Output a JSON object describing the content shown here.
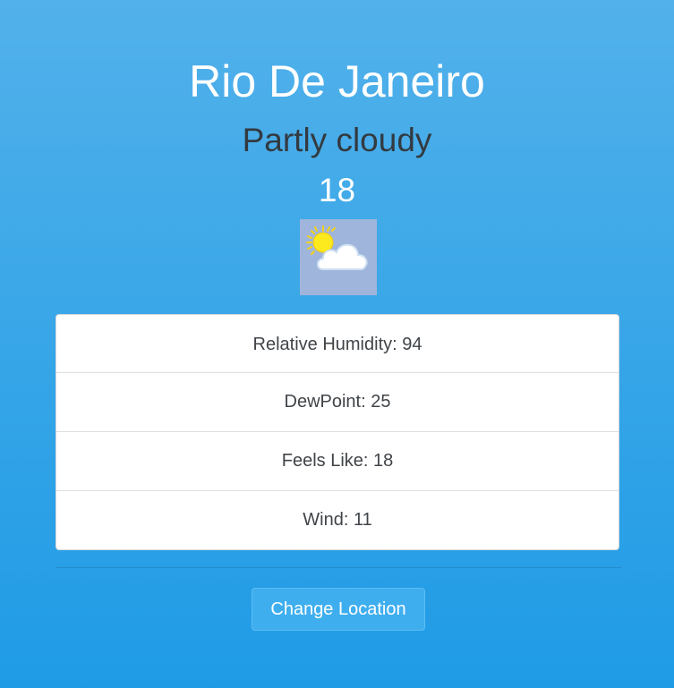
{
  "location": {
    "city": "Rio De Janeiro",
    "condition": "Partly cloudy",
    "temperature": "18",
    "icon": "partly-cloudy-icon"
  },
  "details": [
    {
      "label": "Relative Humidity: 94"
    },
    {
      "label": "DewPoint: 25"
    },
    {
      "label": "Feels Like: 18"
    },
    {
      "label": "Wind: 11"
    }
  ],
  "actions": {
    "change_location_label": "Change Location"
  },
  "colors": {
    "background_top": "#52b1ea",
    "background_bottom": "#1f9be6",
    "icon_background": "#a0b5dc",
    "button": "#3faeef"
  }
}
